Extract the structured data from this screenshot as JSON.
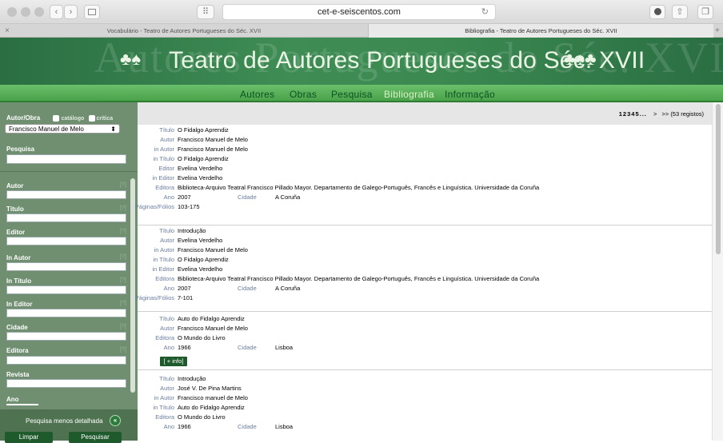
{
  "browser": {
    "url": "cet-e-seiscentos.com",
    "tabs": [
      {
        "label": "Vocabulário - Teatro de Autores Portugueses do Séc. XVII"
      },
      {
        "label": "Bibliografia - Teatro de Autores Portugueses do Séc. XVII"
      }
    ],
    "close_glyph": "×",
    "new_tab_glyph": "+",
    "back_glyph": "‹",
    "forward_glyph": "›",
    "reload_glyph": "↻",
    "grid_glyph": "⠿"
  },
  "banner": {
    "title": "Teatro de Autores Portugueses do Séc. XVII",
    "ghost": "Autores Portugueses do Séc. XVII"
  },
  "menu": [
    {
      "label": "Autores"
    },
    {
      "label": "Obras"
    },
    {
      "label": "Pesquisa"
    },
    {
      "label": "Bibliografia"
    },
    {
      "label": "Informação"
    }
  ],
  "sidebar": {
    "autor_obra_label": "Autor/Obra",
    "catalogo_label": "catálogo",
    "critica_label": "crítica",
    "selected_author": "Francisco Manuel de Melo",
    "pesquisa_label": "Pesquisa",
    "fields": [
      {
        "label": "Autor"
      },
      {
        "label": "Título"
      },
      {
        "label": "Editor"
      },
      {
        "label": "In Autor"
      },
      {
        "label": "In Título"
      },
      {
        "label": "In Editor"
      },
      {
        "label": "Cidade"
      },
      {
        "label": "Editora"
      },
      {
        "label": "Revista"
      },
      {
        "label": "Ano"
      }
    ],
    "help_glyph": "[?]",
    "toggle_label": "Pesquisa menos detalhada",
    "clear_button": "Limpar",
    "search_button": "Pesquisar"
  },
  "pager": {
    "pages": "12345...",
    "next": ">",
    "last": ">>",
    "count": "(53 registos)"
  },
  "labels": {
    "titulo": "Título",
    "autor": "Autor",
    "in_autor": "in Autor",
    "in_titulo": "in Título",
    "editor": "Editor",
    "in_editor": "in Editor",
    "editora": "Editora",
    "ano": "Ano",
    "cidade": "Cidade",
    "paginas": "Páginas/Fólios",
    "info_button": "[ + info]"
  },
  "records": [
    {
      "titulo": "O Fidalgo Aprendiz",
      "autor": "Francisco Manuel de Melo",
      "in_autor": "Francisco Manuel de Melo",
      "in_titulo": "O Fidalgo Aprendiz",
      "editor": "Evelina Verdelho",
      "in_editor": "Evelina Verdelho",
      "editora": "Biblioteca-Arquivo Teatral Francisco Pillado Mayor. Departamento de Galego-Português, Francês e Linguística. Universidade da Coruña",
      "ano": "2007",
      "cidade": "A Coruña",
      "paginas": "103-175"
    },
    {
      "titulo": "Introdução",
      "autor": "Evelina Verdelho",
      "in_autor": "Francisco Manuel de Melo",
      "in_titulo": "O Fidalgo Aprendiz",
      "in_editor": "Evelina Verdelho",
      "editora": "Biblioteca-Arquivo Teatral Francisco Pillado Mayor. Departamento de Galego-Português, Francês e Linguística. Universidade da Coruña",
      "ano": "2007",
      "cidade": "A Coruña",
      "paginas": "7-101"
    },
    {
      "titulo": "Auto do Fidalgo Aprendiz",
      "autor": "Francisco Manuel de Melo",
      "editora": "O Mundo do Livro",
      "ano": "1966",
      "cidade": "Lisboa"
    },
    {
      "titulo": "Introdução",
      "autor": "José V. De Pina Martins",
      "in_autor": "Francisco manuel de Melo",
      "in_titulo": "Auto do Fidalgo Aprendiz",
      "editora": "O Mundo do Livro",
      "ano": "1966",
      "cidade": "Lisboa"
    }
  ]
}
